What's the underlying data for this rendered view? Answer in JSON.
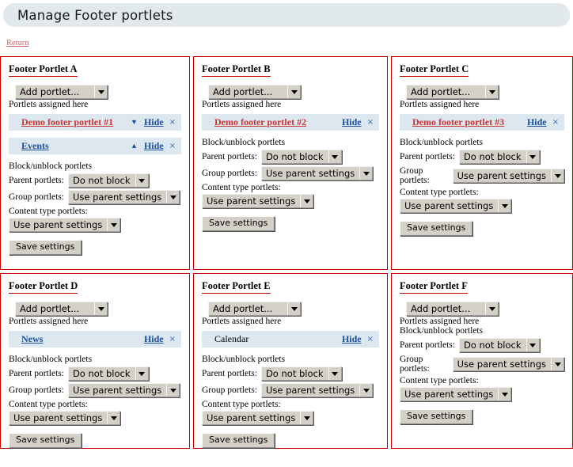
{
  "header": {
    "title": "Manage Footer portlets"
  },
  "return_link": {
    "label": "Return"
  },
  "labels": {
    "assigned_here": "Portlets assigned here",
    "block_unblock": "Block/unblock portlets",
    "parent_portlets": "Parent portlets:",
    "group_portlets": "Group portlets:",
    "content_type_portlets": "Content type portlets:",
    "add_portlet": "Add portlet...",
    "save_settings": "Save settings",
    "hide": "Hide",
    "close_icon": "×",
    "arrow_down": "▼",
    "arrow_up": "▲"
  },
  "select_values": {
    "do_not_block": "Do not block",
    "use_parent_settings": "Use parent settings"
  },
  "panels": [
    {
      "id": "a",
      "title": "Footer Portlet A",
      "add_portlet": "Add portlet...",
      "assigned_note": "Portlets assigned here",
      "portlets": [
        {
          "name": "Demo footer portlet #1",
          "style": "link-red",
          "arrow": "▼",
          "hide": "Hide",
          "close": "×"
        },
        {
          "name": "Events",
          "style": "link-blue",
          "arrow": "▲",
          "hide": "Hide",
          "close": "×"
        }
      ],
      "block_note": "Block/unblock portlets",
      "parent_label": "Parent portlets:",
      "parent_value": "Do not block",
      "group_label": "Group portlets:",
      "group_value": "Use parent settings",
      "content_label": "Content type portlets:",
      "content_value": "Use parent settings",
      "save": "Save settings"
    },
    {
      "id": "b",
      "title": "Footer Portlet B",
      "add_portlet": "Add portlet...",
      "assigned_note": "Portlets assigned here",
      "portlets": [
        {
          "name": "Demo footer portlet #2",
          "style": "link-red",
          "arrow": "",
          "hide": "Hide",
          "close": "×"
        }
      ],
      "block_note": "Block/unblock portlets",
      "parent_label": "Parent portlets:",
      "parent_value": "Do not block",
      "group_label": "Group portlets:",
      "group_value": "Use parent settings",
      "content_label": "Content type portlets:",
      "content_value": "Use parent settings",
      "save": "Save settings"
    },
    {
      "id": "c",
      "title": "Footer Portlet C",
      "add_portlet": "Add portlet...",
      "assigned_note": "Portlets assigned here",
      "portlets": [
        {
          "name": "Demo footer portlet #3",
          "style": "link-red",
          "arrow": "",
          "hide": "Hide",
          "close": "×"
        }
      ],
      "block_note": "Block/unblock portlets",
      "parent_label": "Parent portlets:",
      "parent_value": "Do not block",
      "group_label": "Group portlets:",
      "group_value": "Use parent settings",
      "content_label": "Content type portlets:",
      "content_value": "Use parent settings",
      "save": "Save settings"
    },
    {
      "id": "d",
      "title": "Footer Portlet D",
      "add_portlet": "Add portlet...",
      "assigned_note": "Portlets assigned here",
      "portlets": [
        {
          "name": "News",
          "style": "link-blue",
          "arrow": "",
          "hide": "Hide",
          "close": "×"
        }
      ],
      "block_note": "Block/unblock portlets",
      "parent_label": "Parent portlets:",
      "parent_value": "Do not block",
      "group_label": "Group portlets:",
      "group_value": "Use parent settings",
      "content_label": "Content type portlets:",
      "content_value": "Use parent settings",
      "save": "Save settings"
    },
    {
      "id": "e",
      "title": "Footer Portlet E",
      "add_portlet": "Add portlet...",
      "assigned_note": "Portlets assigned here",
      "portlets": [
        {
          "name": "Calendar",
          "style": "plain",
          "arrow": "",
          "hide": "Hide",
          "close": "×"
        }
      ],
      "block_note": "Block/unblock portlets",
      "parent_label": "Parent portlets:",
      "parent_value": "Do not block",
      "group_label": "Group portlets:",
      "group_value": "Use parent settings",
      "content_label": "Content type portlets:",
      "content_value": "Use parent settings",
      "save": "Save settings"
    },
    {
      "id": "f",
      "title": "Footer Portlet F",
      "add_portlet": "Add portlet...",
      "assigned_note": "Portlets assigned here",
      "portlets": [],
      "block_note": "Block/unblock portlets",
      "parent_label": "Parent portlets:",
      "parent_value": "Do not block",
      "group_label": "Group portlets:",
      "group_value": "Use parent settings",
      "content_label": "Content type portlets:",
      "content_value": "Use parent settings",
      "save": "Save settings"
    }
  ],
  "colors": {
    "panel_border": "#cc0000",
    "header_bar": "#e2e9ed",
    "row_highlight": "#dce7ef",
    "link_blue": "#1a4f9c",
    "link_red": "#cc3333",
    "return_link": "#d06c6c"
  }
}
